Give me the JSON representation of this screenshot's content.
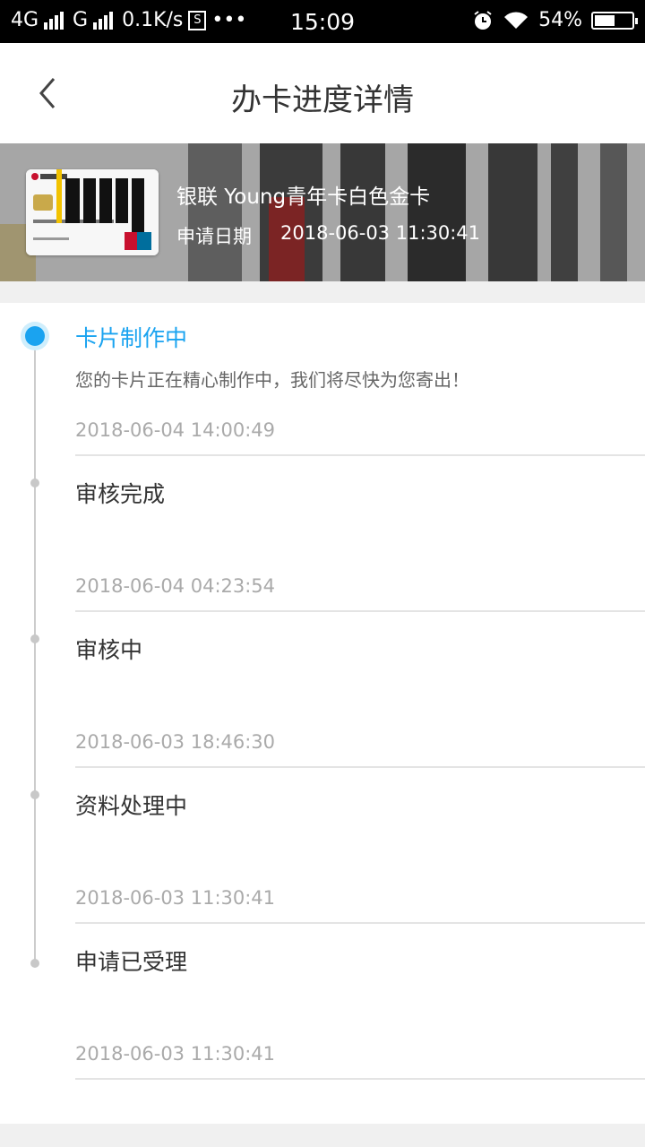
{
  "status_bar": {
    "network_1": "4G",
    "network_2": "G",
    "speed": "0.1K/s",
    "more": "•••",
    "time": "15:09",
    "battery": "54%",
    "battery_level": 0.54
  },
  "header": {
    "title": "办卡进度详情"
  },
  "card": {
    "name": "银联 Young青年卡白色金卡",
    "date_label": "申请日期",
    "date_value": "2018-06-03 11:30:41"
  },
  "timeline": {
    "steps": [
      {
        "title": "卡片制作中",
        "desc": "您的卡片正在精心制作中，我们将尽快为您寄出！",
        "time": "2018-06-04 14:00:49"
      },
      {
        "title": "审核完成",
        "time": "2018-06-04 04:23:54"
      },
      {
        "title": "审核中",
        "time": "2018-06-03 18:46:30"
      },
      {
        "title": "资料处理中",
        "time": "2018-06-03 11:30:41"
      },
      {
        "title": "申请已受理",
        "time": "2018-06-03 11:30:41"
      }
    ]
  },
  "colors": {
    "accent": "#1aa3f0",
    "status_bar_bg": "#000000"
  }
}
